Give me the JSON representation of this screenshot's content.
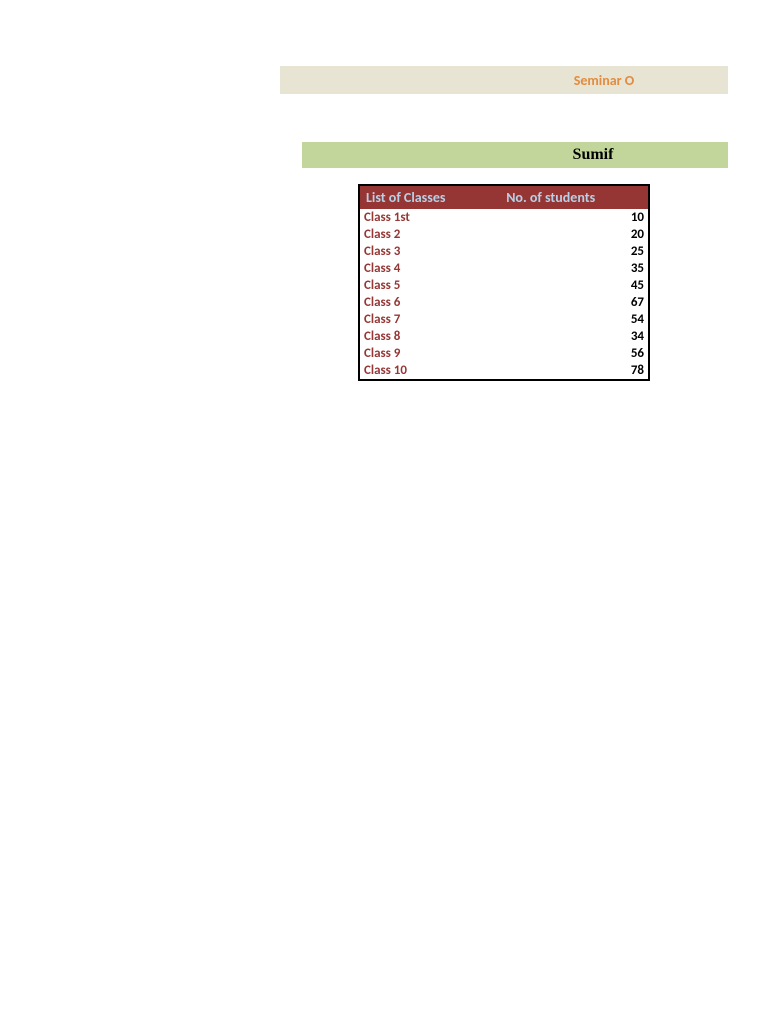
{
  "banner": {
    "top_text": "Seminar O",
    "section_title": "Sumif"
  },
  "table": {
    "headers": {
      "col1": "List of Classes",
      "col2": "No. of students"
    },
    "rows": [
      {
        "class": "Class 1st",
        "students": "10"
      },
      {
        "class": "Class 2",
        "students": "20"
      },
      {
        "class": "Class 3",
        "students": "25"
      },
      {
        "class": "Class 4",
        "students": "35"
      },
      {
        "class": "Class 5",
        "students": "45"
      },
      {
        "class": "Class 6",
        "students": "67"
      },
      {
        "class": "Class 7",
        "students": "54"
      },
      {
        "class": "Class 8",
        "students": "34"
      },
      {
        "class": "Class 9",
        "students": "56"
      },
      {
        "class": "Class 10",
        "students": "78"
      }
    ]
  }
}
